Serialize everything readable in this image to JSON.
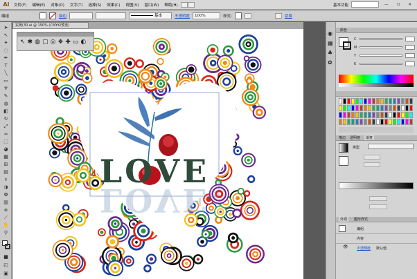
{
  "app": {
    "logo": "Ai"
  },
  "menubar": {
    "items": [
      "文件(F)",
      "编辑(E)",
      "对象(O)",
      "文字(T)",
      "选择(S)",
      "效果(C)",
      "视图(V)",
      "窗口(W)",
      "帮助(H)"
    ],
    "workspace_label": "基本功能"
  },
  "controlbar": {
    "object_label": "编组",
    "stroke_link": "描边",
    "stroke_style": "基本",
    "opacity_link": "不透明度",
    "opacity_value": "100%",
    "style_label": "样式:",
    "transform_link": "变换"
  },
  "document": {
    "tab_title": "实例(30.ai @ 150% (CMYK/预览)"
  },
  "canvas": {
    "word_love": "LOVE",
    "colors": {
      "red": "#d9261c",
      "orange": "#f08a18",
      "yellow": "#f2c21a",
      "green": "#2b9a3c",
      "blue": "#1b3f9c",
      "purple": "#6b2a8c",
      "black": "#111111",
      "heart": "#ffffff"
    }
  },
  "panels": {
    "color": {
      "title": "颜色",
      "channels": [
        "C",
        "M",
        "Y",
        "K"
      ]
    },
    "gradient": {
      "tabs": [
        "描边",
        "透明度",
        "渐变"
      ],
      "type_label": "类型"
    },
    "appearance": {
      "tabs": [
        "外观",
        "图形样式"
      ],
      "item_group": "编组",
      "item_contents": "内容",
      "opacity_link": "不透明度",
      "opacity_value": "默认值"
    }
  }
}
